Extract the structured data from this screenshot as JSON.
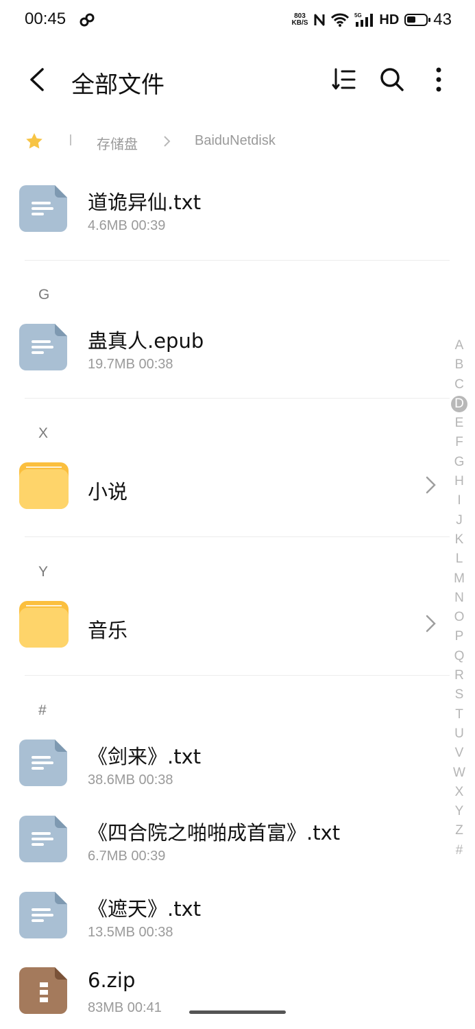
{
  "status_bar": {
    "time": "00:45",
    "net_speed_value": "803",
    "net_speed_unit": "KB/S",
    "network": "5G",
    "hd": "HD",
    "battery": "43"
  },
  "header": {
    "title": "全部文件"
  },
  "breadcrumb": {
    "items": [
      "存储盘",
      "BaiduNetdisk"
    ]
  },
  "files": [
    {
      "name": "道诡异仙.txt",
      "meta": "4.6MB  00:39",
      "type": "text"
    },
    {
      "section": "G"
    },
    {
      "name": "蛊真人.epub",
      "meta": "19.7MB  00:38",
      "type": "text"
    },
    {
      "section": "X"
    },
    {
      "name": "小说",
      "type": "folder"
    },
    {
      "section": "Y"
    },
    {
      "name": "音乐",
      "type": "folder"
    },
    {
      "section": "#"
    },
    {
      "name": "《剑来》.txt",
      "meta": "38.6MB  00:38",
      "type": "text"
    },
    {
      "name": "《四合院之啪啪成首富》.txt",
      "meta": "6.7MB  00:39",
      "type": "text"
    },
    {
      "name": "《遮天》.txt",
      "meta": "13.5MB  00:38",
      "type": "text"
    },
    {
      "name": "6.zip",
      "meta": "83MB  00:41",
      "type": "zip"
    }
  ],
  "sections": {
    "g": "G",
    "x": "X",
    "y": "Y",
    "hash": "#"
  },
  "alphabet_index": {
    "letters": [
      "A",
      "B",
      "C",
      "D",
      "E",
      "F",
      "G",
      "H",
      "I",
      "J",
      "K",
      "L",
      "M",
      "N",
      "O",
      "P",
      "Q",
      "R",
      "S",
      "T",
      "U",
      "V",
      "W",
      "X",
      "Y",
      "Z",
      "#"
    ],
    "active": "D"
  },
  "colors": {
    "doc_icon": "#a9bfd3",
    "doc_fold": "#7e99b1",
    "folder": "#fed46a",
    "zip": "#a47a5c",
    "star": "#f7c445"
  }
}
